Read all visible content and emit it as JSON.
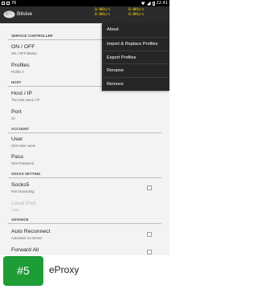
{
  "status_bar": {
    "notif_count": "76",
    "time": "22:41"
  },
  "action_bar": {
    "title": "Bitvise",
    "speed_1": "0:0Kb/s\n0:0Kb/s",
    "speed_2": "0:0Kb/s\n0:0Kb/s"
  },
  "settings": {
    "service_controller": {
      "header": "SERVICE CONTROLLER",
      "on_off": {
        "title": "ON / OFF",
        "summary": "ON / OFF Bitvise"
      },
      "profiles": {
        "title": "Profiles",
        "summary": "Profile 3"
      }
    },
    "host": {
      "header": "HOST",
      "host_ip": {
        "title": "Host / IP",
        "summary": "The host name / IP"
      },
      "port": {
        "title": "Port",
        "summary": "22"
      }
    },
    "account": {
      "header": "ACCOUNT",
      "user": {
        "title": "User",
        "summary": "SSH User name"
      },
      "pass": {
        "title": "Pass",
        "summary": "SSH Password"
      }
    },
    "socks": {
      "header": "SOCKS SETTING",
      "socks5": {
        "title": "Socks5",
        "summary": "Port forwarding"
      },
      "local_port": {
        "title": "Local Port",
        "summary": "1080"
      }
    },
    "advance": {
      "header": "ADVANCE",
      "auto_reconnect": {
        "title": "Auto Reconnect",
        "summary": "Automatic reconnect"
      },
      "forward_all": {
        "title": "Forward All"
      }
    }
  },
  "menu": {
    "items": [
      "About",
      "Import & Replace Profiles",
      "Export Profiles",
      "Rename",
      "Remove"
    ]
  },
  "banner": {
    "rank": "#5",
    "app_name": "eProxy",
    "accent": "#1e9c36"
  }
}
